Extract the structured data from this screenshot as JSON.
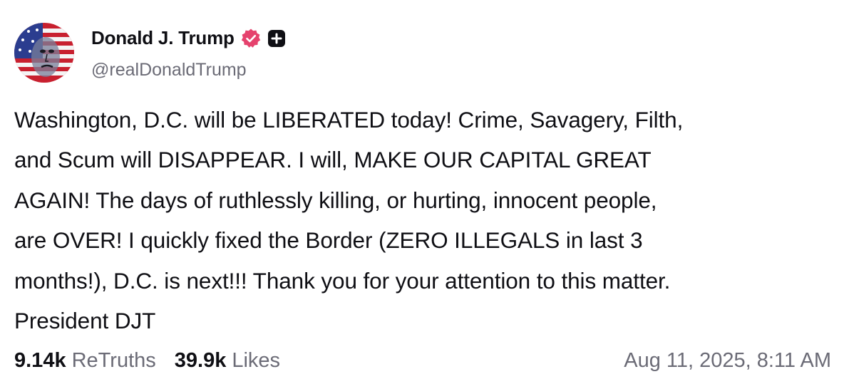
{
  "author": {
    "display_name": "Donald J. Trump",
    "handle": "@realDonaldTrump",
    "verified_badge": "verified-icon",
    "subscription_badge": "plus-icon",
    "badge_color": "#e5426d"
  },
  "post": {
    "lines": [
      "Washington, D.C. will be LIBERATED today! Crime, Savagery, Filth,",
      "and Scum will DISAPPEAR. I will, MAKE OUR CAPITAL GREAT",
      "AGAIN! The days of ruthlessly killing, or hurting, innocent people,",
      "are OVER! I quickly fixed the Border (ZERO ILLEGALS in last 3",
      "months!), D.C. is next!!! Thank you for your attention to this matter.",
      "President DJT"
    ]
  },
  "stats": {
    "retruths_count": "9.14k",
    "retruths_label": "ReTruths",
    "likes_count": "39.9k",
    "likes_label": "Likes"
  },
  "timestamp": "Aug 11, 2025, 8:11 AM"
}
